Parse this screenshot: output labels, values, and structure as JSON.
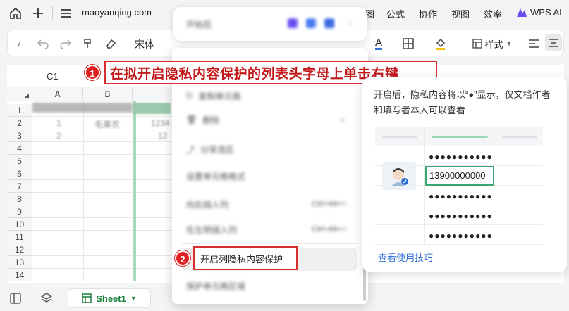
{
  "topbar": {
    "domain": "maoyanqing.com",
    "menu": [
      "公式",
      "协作",
      "视图",
      "效率"
    ],
    "partial_menu": "图",
    "wps_ai": "WPS AI"
  },
  "toolbar": {
    "font_name": "宋体",
    "style_label": "样式"
  },
  "sheet": {
    "name_box": "C1",
    "columns": [
      "A",
      "B"
    ],
    "rows": [
      "1",
      "2",
      "3",
      "4",
      "5",
      "6",
      "7",
      "8",
      "9",
      "10",
      "11",
      "12",
      "13",
      "14"
    ],
    "blurred_cells": {
      "a2": "1",
      "b2": "毛果农",
      "c2": "1234",
      "a3": "2",
      "c3": "12"
    }
  },
  "bottombar": {
    "sheet_tab": "Sheet1"
  },
  "mini_toolbar": {
    "label": "开始后"
  },
  "context_menu": {
    "items": [
      {
        "text": "复制单元格"
      },
      {
        "text": "删除"
      },
      {
        "text": "分享选区"
      },
      {
        "text": "设置单元格格式"
      },
      {
        "text": "向右插入列"
      },
      {
        "text": "在左侧插入列"
      },
      {
        "text": "保护单元格区域"
      }
    ],
    "shortcut_1": "Ctrl+Alt+=",
    "shortcut_2": "Ctrl+Alt+=",
    "target": "开启列隐私内容保护"
  },
  "callout": {
    "step1": "1",
    "step2": "2",
    "text": "在拟开启隐私内容保护的列表头字母上单击右键"
  },
  "tip": {
    "desc": "开启后，隐私内容将以“●”显示，仅文档作者和填写者本人可以查看",
    "phone": "13900000000",
    "mask": "●●●●●●●●●●●",
    "link": "查看使用技巧"
  },
  "colors": {
    "accent_red": "#d72d2d",
    "green": "#1a7f3c",
    "link_blue": "#2f6fd6"
  }
}
